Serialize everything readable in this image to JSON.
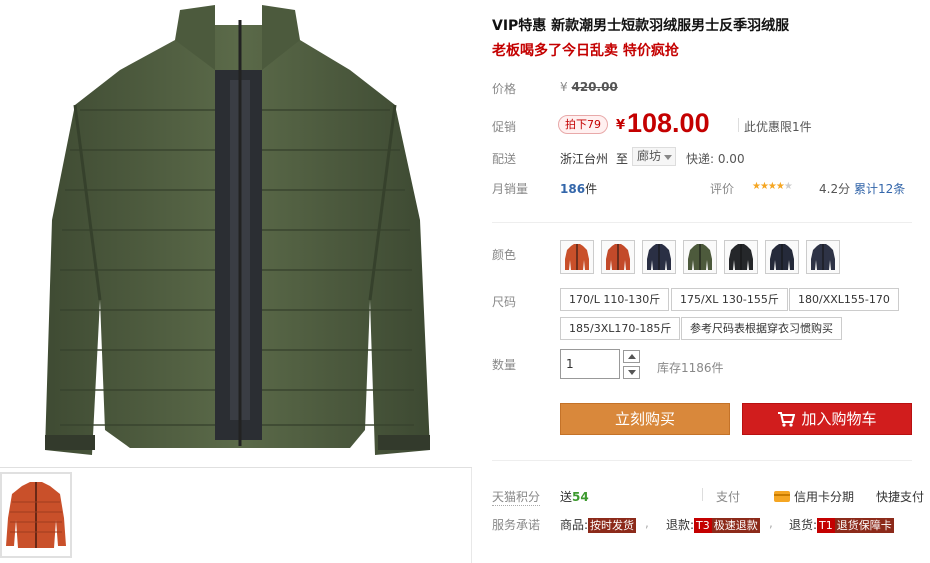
{
  "product": {
    "title": "VIP特惠 新款潮男士短款羽绒服男士反季羽绒服",
    "subtitle": "老板喝多了今日乱卖 特价疯抢"
  },
  "price": {
    "label": "价格",
    "currency": "¥",
    "original": "420.00"
  },
  "promo": {
    "label": "促销",
    "badge": "拍下79",
    "currency": "¥",
    "price": "108.00",
    "limit": "此优惠限1件"
  },
  "shipping": {
    "label": "配送",
    "from": "浙江台州",
    "to_label": "至",
    "to_value": "廊坊",
    "fee": "快递: 0.00"
  },
  "sales": {
    "label": "月销量",
    "count": "186",
    "unit": "件",
    "rating_label": "评价",
    "stars_on": "★★★★",
    "stars_off": "★",
    "score": "4.2分",
    "reviews": "累计12条"
  },
  "color": {
    "label": "颜色",
    "options": [
      {
        "name": "orange-1",
        "hex": "#c9502a"
      },
      {
        "name": "orange-2",
        "hex": "#c34a2a"
      },
      {
        "name": "navy",
        "hex": "#2a2f44"
      },
      {
        "name": "army-green",
        "hex": "#4d5a3c"
      },
      {
        "name": "black",
        "hex": "#25272a"
      },
      {
        "name": "dark-navy",
        "hex": "#252a3a"
      },
      {
        "name": "charcoal-blue",
        "hex": "#2e3346"
      }
    ]
  },
  "size": {
    "label": "尺码",
    "options": [
      "170/L 110-130斤",
      "175/XL 130-155斤",
      "180/XXL155-170",
      "185/3XL170-185斤",
      "参考尺码表根据穿衣习惯购买"
    ]
  },
  "quantity": {
    "label": "数量",
    "value": "1",
    "stock": "库存1186件"
  },
  "actions": {
    "buy_now": "立刻购买",
    "add_to_cart": "加入购物车"
  },
  "points": {
    "label": "天猫积分",
    "prefix": "送",
    "value": "54",
    "pay_label": "支付",
    "credit": "信用卡分期",
    "quick_pay": "快捷支付"
  },
  "service": {
    "label": "服务承诺",
    "goods_label": "商品:",
    "goods_tag": "按时发货",
    "refund_label": "退款:",
    "refund_code": "T3",
    "refund_tag": "极速退款",
    "return_label": "退货:",
    "return_code": "T1",
    "return_tag": "退货保障卡"
  },
  "colors": {
    "accent_red": "#c40000",
    "buy_orange": "#d9883b",
    "cart_red": "#d11d1d",
    "jacket_green": "#4b5a3d"
  }
}
